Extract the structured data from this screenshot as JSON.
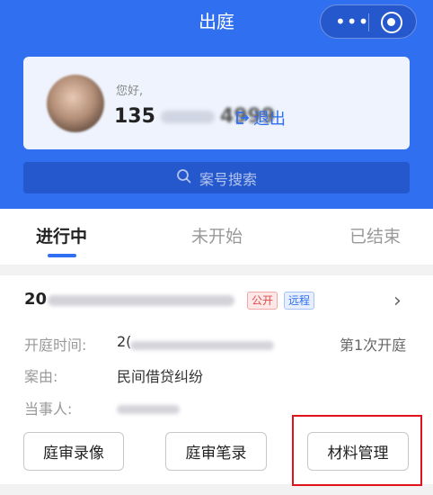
{
  "header": {
    "title": "出庭",
    "more_icon": "more-dots-icon",
    "close_icon": "target-icon"
  },
  "user": {
    "greeting": "您好,",
    "phone_prefix": "135",
    "phone_suffix": "4999",
    "logout_label": "退出"
  },
  "search": {
    "placeholder": "案号搜索"
  },
  "tabs": [
    {
      "label": "进行中",
      "active": true
    },
    {
      "label": "未开始",
      "active": false
    },
    {
      "label": "已结束",
      "active": false
    }
  ],
  "case": {
    "case_prefix": "20",
    "tags": [
      "公开",
      "远程"
    ],
    "time_label": "开庭时间:",
    "time_prefix": "2(",
    "session_text": "第1次开庭",
    "cause_label": "案由:",
    "cause_value": "民间借贷纠纷",
    "party_label": "当事人:"
  },
  "actions": {
    "video": "庭审录像",
    "notes": "庭审笔录",
    "materials": "材料管理"
  },
  "colors": {
    "brand": "#2f6ff0",
    "highlight": "#e0121b"
  }
}
